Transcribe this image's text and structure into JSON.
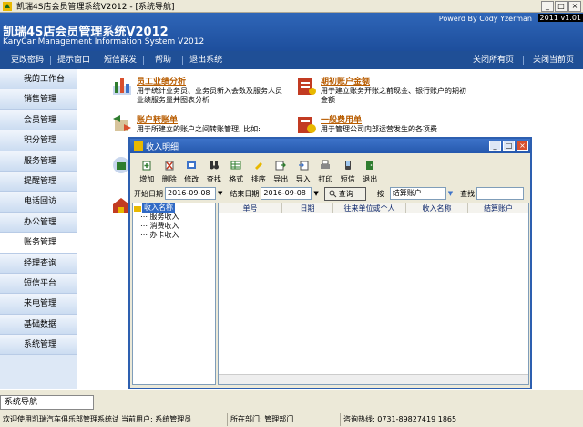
{
  "window": {
    "title": "凯瑞4S店会员管理系统V2012 - [系统导航]"
  },
  "banner": {
    "title": "凯瑞4S店会员管理系统V2012",
    "subtitle": "KaryCar Management Information System V2012",
    "powered_by": "Powerd By Cody Yzerman",
    "version_badge": "2011 v1.01"
  },
  "menubar": {
    "items": [
      "更改密码",
      "提示窗口",
      "短信群发",
      "帮助",
      "退出系统"
    ],
    "right_items": [
      "关闭所有页",
      "关闭当前页"
    ]
  },
  "sidebar": {
    "items": [
      "我的工作台",
      "销售管理",
      "会员管理",
      "积分管理",
      "服务管理",
      "提醒管理",
      "电话回访",
      "办公管理",
      "账务管理",
      "经理查询",
      "短信平台",
      "来电管理",
      "基础数据",
      "系统管理"
    ],
    "active": "账务管理"
  },
  "features": [
    {
      "title": "员工业绩分析",
      "desc": "用于统计业务员、业务员新入会数及服务人员业绩服务量并图表分析"
    },
    {
      "title": "期初账户金额",
      "desc": "用于建立账务开账之前现金、银行账户的期初金额"
    },
    {
      "title": "账户转账单",
      "desc": "用于所建立的账户之间转账管理, 比如:"
    },
    {
      "title": "一般费用单",
      "desc": "用于管理公司内部运营发生的各项费"
    }
  ],
  "dialog": {
    "title": "收入明细",
    "toolbar": [
      "增加",
      "删除",
      "修改",
      "查找",
      "格式",
      "排序",
      "导出",
      "导入",
      "打印",
      "短信",
      "退出"
    ],
    "filter": {
      "start_label": "开始日期",
      "start_value": "2016-09-08",
      "end_label": "结束日期",
      "end_value": "2016-09-08",
      "query_button": "查询",
      "by_label": "按",
      "by_value": "结算账户",
      "find_label": "查找"
    },
    "tree": {
      "root": "收入名称",
      "children": [
        "服务收入",
        "消费收入",
        "办卡收入"
      ]
    },
    "columns": [
      "单号",
      "日期",
      "往来单位或个人",
      "收入名称",
      "结算账户"
    ]
  },
  "tabstrip": {
    "tab": "系统导航"
  },
  "status": {
    "welcome": "欢迎使用凯瑞汽车俱乐部管理系统试用版",
    "user": "当前用户: 系统管理员",
    "dept": "所在部门: 管理部门",
    "hotline": "咨询热线: 0731-89827419 1865"
  },
  "colors": {
    "accent": "#1f4f96",
    "link": "#b85c00"
  }
}
